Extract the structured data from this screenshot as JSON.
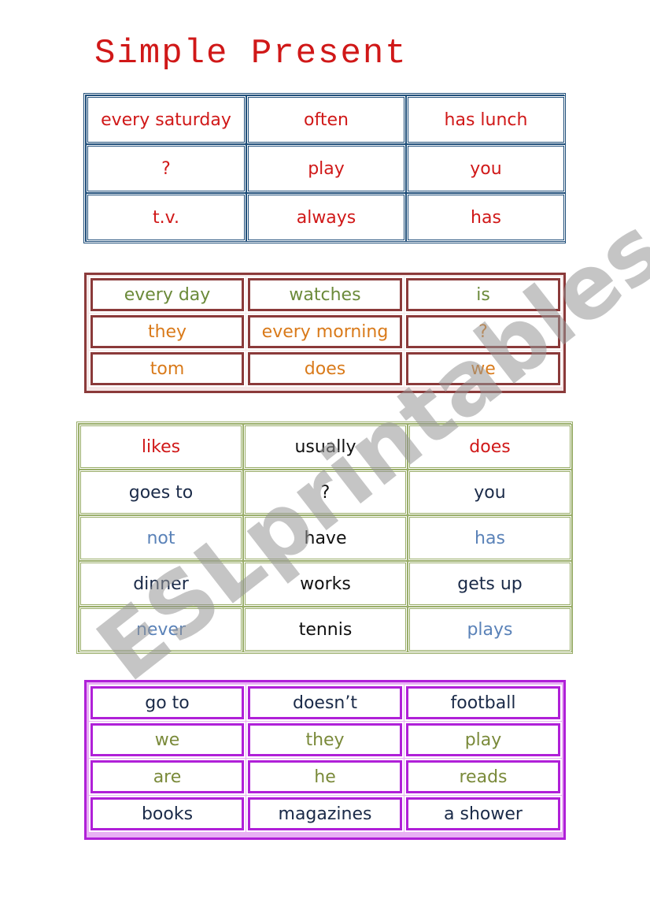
{
  "title": "Simple Present",
  "watermark": "ESLprintables.com",
  "colors": {
    "red": "#d01818",
    "green": "#6b8a3a",
    "orange": "#d97a1a",
    "navy": "#1a2a48",
    "black": "#111111",
    "steel_blue": "#5a82b8",
    "olive": "#7a8a3a"
  },
  "tables": [
    {
      "rows": [
        [
          {
            "text": "every saturday",
            "color": "#d01818"
          },
          {
            "text": "often",
            "color": "#d01818"
          },
          {
            "text": "has lunch",
            "color": "#d01818"
          }
        ],
        [
          {
            "text": "?",
            "color": "#d01818"
          },
          {
            "text": "play",
            "color": "#d01818"
          },
          {
            "text": "you",
            "color": "#d01818"
          }
        ],
        [
          {
            "text": "t.v.",
            "color": "#d01818"
          },
          {
            "text": "always",
            "color": "#d01818"
          },
          {
            "text": "has",
            "color": "#d01818"
          }
        ]
      ]
    },
    {
      "rows": [
        [
          {
            "text": "every day",
            "color": "#6b8a3a"
          },
          {
            "text": "watches",
            "color": "#6b8a3a"
          },
          {
            "text": "is",
            "color": "#6b8a3a"
          }
        ],
        [
          {
            "text": "they",
            "color": "#d97a1a"
          },
          {
            "text": "every morning",
            "color": "#d97a1a"
          },
          {
            "text": "?",
            "color": "#d97a1a"
          }
        ],
        [
          {
            "text": "tom",
            "color": "#d97a1a"
          },
          {
            "text": "does",
            "color": "#d97a1a"
          },
          {
            "text": "we",
            "color": "#d97a1a"
          }
        ]
      ]
    },
    {
      "rows": [
        [
          {
            "text": "likes",
            "color": "#d01818"
          },
          {
            "text": "usually",
            "color": "#111111"
          },
          {
            "text": "does",
            "color": "#d01818"
          }
        ],
        [
          {
            "text": "goes to",
            "color": "#1a2a48"
          },
          {
            "text": "?",
            "color": "#111111"
          },
          {
            "text": "you",
            "color": "#1a2a48"
          }
        ],
        [
          {
            "text": "not",
            "color": "#5a82b8"
          },
          {
            "text": "have",
            "color": "#111111"
          },
          {
            "text": "has",
            "color": "#5a82b8"
          }
        ],
        [
          {
            "text": "dinner",
            "color": "#1a2a48"
          },
          {
            "text": "works",
            "color": "#111111"
          },
          {
            "text": "gets up",
            "color": "#1a2a48"
          }
        ],
        [
          {
            "text": "never",
            "color": "#5a82b8"
          },
          {
            "text": "tennis",
            "color": "#111111"
          },
          {
            "text": "plays",
            "color": "#5a82b8"
          }
        ]
      ]
    },
    {
      "rows": [
        [
          {
            "text": "go to",
            "color": "#1a2a48"
          },
          {
            "text": "doesn’t",
            "color": "#1a2a48"
          },
          {
            "text": "football",
            "color": "#1a2a48"
          }
        ],
        [
          {
            "text": "we",
            "color": "#7a8a3a"
          },
          {
            "text": "they",
            "color": "#7a8a3a"
          },
          {
            "text": "play",
            "color": "#7a8a3a"
          }
        ],
        [
          {
            "text": "are",
            "color": "#7a8a3a"
          },
          {
            "text": "he",
            "color": "#7a8a3a"
          },
          {
            "text": "reads",
            "color": "#7a8a3a"
          }
        ],
        [
          {
            "text": "books",
            "color": "#1a2a48"
          },
          {
            "text": "magazines",
            "color": "#1a2a48"
          },
          {
            "text": "a shower",
            "color": "#1a2a48"
          }
        ]
      ]
    }
  ]
}
